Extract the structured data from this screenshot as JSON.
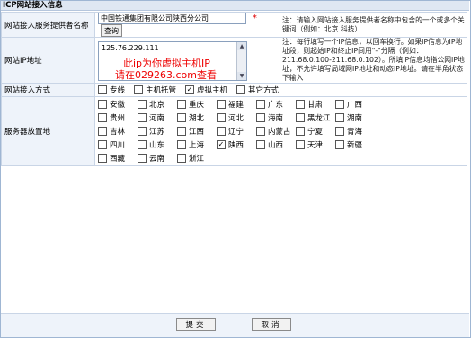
{
  "title": "ICP网站接入信息",
  "provider": {
    "label": "网站接入服务提供者名称",
    "value": "中国铁通集团有限公司陕西分公司",
    "required_mark": "*",
    "query_button": "查询",
    "note": "注：请输入网站接入服务提供者名称中包含的一个或多个关键词（例如：北京 科技）"
  },
  "ip": {
    "label": "网站IP地址",
    "value": "125.76.229.111",
    "watermark_line1": "此ip为你虚拟主机IP",
    "watermark_line2": "请在029263.com查看",
    "note": "注：每行填写一个IP信息，以回车换行。如果IP信息为IP地址段，则起始IP和终止IP间用\"-\"分隔（例如：211.68.0.100-211.68.0.102）。所填IP信息均指公网IP地址，不允许填写局域网IP地址和动态IP地址。请在半角状态下输入"
  },
  "access": {
    "label": "网站接入方式",
    "options": [
      {
        "label": "专线",
        "checked": false
      },
      {
        "label": "主机托管",
        "checked": false
      },
      {
        "label": "虚拟主机",
        "checked": true
      },
      {
        "label": "其它方式",
        "checked": false
      }
    ]
  },
  "location": {
    "label": "服务器放置地",
    "regions": [
      {
        "label": "安徽",
        "checked": false
      },
      {
        "label": "北京",
        "checked": false
      },
      {
        "label": "重庆",
        "checked": false
      },
      {
        "label": "福建",
        "checked": false
      },
      {
        "label": "广东",
        "checked": false
      },
      {
        "label": "甘肃",
        "checked": false
      },
      {
        "label": "广西",
        "checked": false
      },
      {
        "label": "贵州",
        "checked": false
      },
      {
        "label": "河南",
        "checked": false
      },
      {
        "label": "湖北",
        "checked": false
      },
      {
        "label": "河北",
        "checked": false
      },
      {
        "label": "海南",
        "checked": false
      },
      {
        "label": "黑龙江",
        "checked": false
      },
      {
        "label": "湖南",
        "checked": false
      },
      {
        "label": "吉林",
        "checked": false
      },
      {
        "label": "江苏",
        "checked": false
      },
      {
        "label": "江西",
        "checked": false
      },
      {
        "label": "辽宁",
        "checked": false
      },
      {
        "label": "内蒙古",
        "checked": false
      },
      {
        "label": "宁夏",
        "checked": false
      },
      {
        "label": "青海",
        "checked": false
      },
      {
        "label": "四川",
        "checked": false
      },
      {
        "label": "山东",
        "checked": false
      },
      {
        "label": "上海",
        "checked": false
      },
      {
        "label": "陕西",
        "checked": true
      },
      {
        "label": "山西",
        "checked": false
      },
      {
        "label": "天津",
        "checked": false
      },
      {
        "label": "新疆",
        "checked": false
      },
      {
        "label": "西藏",
        "checked": false
      },
      {
        "label": "云南",
        "checked": false
      },
      {
        "label": "浙江",
        "checked": false
      }
    ]
  },
  "footer": {
    "submit": "提交",
    "cancel": "取消"
  }
}
